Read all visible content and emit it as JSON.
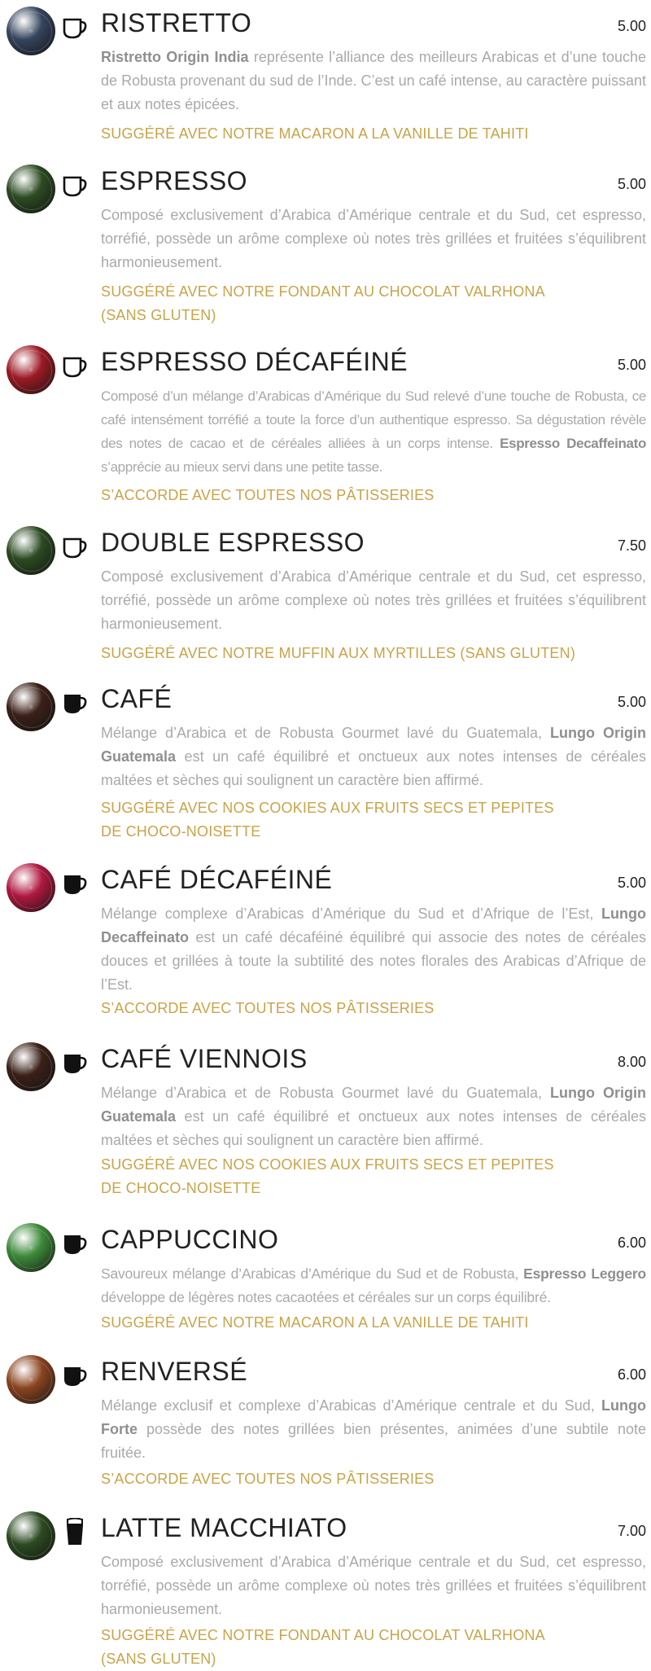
{
  "colors": {
    "title": "#222222",
    "description": "#a9a9a9",
    "pairing": "#c9a349"
  },
  "items": [
    {
      "title": "RISTRETTO",
      "price": "5.00",
      "cup_icon": "espresso-cup-icon",
      "capsule_color": "#35445d",
      "desc_pre": "",
      "desc_bold": "Ristretto Origin India",
      "desc_post": " représente l’alliance des meilleurs Arabicas et d’une touche de Robusta provenant du sud de l’Inde. C’est un café intense, au caractère puissant et aux notes épicées.",
      "pairing_1": "SUGGÉRÉ AVEC NOTRE MACARON A LA VANILLE DE TAHITI",
      "pairing_2": ""
    },
    {
      "title": "ESPRESSO",
      "price": "5.00",
      "cup_icon": "espresso-cup-icon",
      "capsule_color": "#2c4a22",
      "desc_pre": "Composé exclusivement d’Arabica d’Amérique centrale et du Sud, cet espresso, torréfié, possède un arôme complexe où notes très grillées et fruitées s’équilibrent harmonieusement.",
      "desc_bold": "",
      "desc_post": "",
      "pairing_1": "SUGGÉRÉ AVEC NOTRE FONDANT AU CHOCOLAT VALRHONA",
      "pairing_2": "(SANS GLUTEN)"
    },
    {
      "title": "ESPRESSO DÉCAFÉINÉ",
      "price": "5.00",
      "cup_icon": "espresso-cup-icon",
      "capsule_color": "#9c1a24",
      "desc_pre": "Composé d’un mélange d’Arabicas d’Amérique du Sud relevé d’une touche de Robusta, ce café intensément torréfié a toute la force d’un authentique espresso. Sa dégustation révèle des notes de cacao et de céréales alliées à un corps intense. ",
      "desc_bold": "Espresso Decaffeinato",
      "desc_post": " s’apprécie au mieux servi dans une petite tasse.",
      "pairing_1": "S’ACCORDE AVEC TOUTES NOS PÂTISSERIES",
      "pairing_2": ""
    },
    {
      "title": "DOUBLE ESPRESSO",
      "price": "7.50",
      "cup_icon": "espresso-cup-icon",
      "capsule_color": "#2c4a22",
      "desc_pre": "Composé exclusivement d’Arabica d’Amérique centrale et du Sud, cet espresso, torréfié, possède un arôme complexe où notes très grillées et fruitées s’équilibrent harmonieusement.",
      "desc_bold": "",
      "desc_post": "",
      "pairing_1": "SUGGÉRÉ AVEC NOTRE MUFFIN AUX MYRTILLES (SANS GLUTEN)",
      "pairing_2": ""
    },
    {
      "title": "CAFÉ",
      "price": "5.00",
      "cup_icon": "coffee-cup-icon",
      "capsule_color": "#3a2018",
      "desc_pre": "Mélange d’Arabica et de Robusta Gourmet lavé du Guatemala, ",
      "desc_bold": "Lungo Origin Guatemala",
      "desc_post": " est un café équilibré et onctueux aux notes intenses de céréales maltées et sèches qui soulignent un caractère bien affirmé.",
      "pairing_1": "SUGGÉRÉ AVEC NOS COOKIES AUX FRUITS SECS ET PEPITES",
      "pairing_2": "DE CHOCO-NOISETTE"
    },
    {
      "title": "CAFÉ DÉCAFÉINÉ",
      "price": "5.00",
      "cup_icon": "coffee-cup-icon",
      "capsule_color": "#b01840",
      "desc_pre": "Mélange complexe d’Arabicas d’Amérique du Sud et d’Afrique de l’Est, ",
      "desc_bold": "Lungo Decaffeinato",
      "desc_post": " est un café décaféiné équilibré qui associe des notes de céréales douces et grillées à toute la subtilité des notes florales des Arabicas d’Afrique de l’Est.",
      "pairing_1": "S’ACCORDE AVEC TOUTES NOS PÂTISSERIES",
      "pairing_2": ""
    },
    {
      "title": "CAFÉ VIENNOIS",
      "price": "8.00",
      "cup_icon": "coffee-cup-icon",
      "capsule_color": "#3a2018",
      "desc_pre": "Mélange d’Arabica et de Robusta Gourmet lavé du Guatemala, ",
      "desc_bold": "Lungo Origin Guatemala",
      "desc_post": " est un café équilibré et onctueux aux notes intenses de céréales maltées et sèches qui soulignent un caractère bien affirmé.",
      "pairing_1": "SUGGÉRÉ AVEC NOS COOKIES AUX FRUITS SECS ET PEPITES",
      "pairing_2": "DE CHOCO-NOISETTE"
    },
    {
      "title": "CAPPUCCINO",
      "price": "6.00",
      "cup_icon": "coffee-cup-icon",
      "capsule_color": "#3d8a3a",
      "desc_pre": "Savoureux mélange d’Arabicas d’Amérique du Sud et de Robusta, ",
      "desc_bold": "Espresso Leggero",
      "desc_post": " développe de légères notes cacaotées et céréales sur un corps équilibré.",
      "pairing_1": "SUGGÉRÉ AVEC NOTRE MACARON A LA VANILLE DE TAHITI",
      "pairing_2": ""
    },
    {
      "title": "RENVERSÉ",
      "price": "6.00",
      "cup_icon": "coffee-cup-icon",
      "capsule_color": "#8a4420",
      "desc_pre": "Mélange exclusif et complexe d’Arabicas d’Amérique centrale et du Sud, ",
      "desc_bold": "Lungo Forte",
      "desc_post": " possède des notes grillées bien présentes, animées d’une subtile note fruitée.",
      "pairing_1": "S’ACCORDE AVEC TOUTES NOS PÂTISSERIES",
      "pairing_2": ""
    },
    {
      "title": "LATTE MACCHIATO",
      "price": "7.00",
      "cup_icon": "latte-glass-icon",
      "capsule_color": "#2c4a22",
      "desc_pre": "Composé exclusivement d’Arabica d’Amérique centrale et du Sud, cet espresso, torréfié, possède un arôme complexe où notes très grillées et fruitées s’équilibrent harmonieusement.",
      "desc_bold": "",
      "desc_post": "",
      "pairing_1": "SUGGÉRÉ AVEC NOTRE FONDANT AU CHOCOLAT VALRHONA",
      "pairing_2": "(SANS GLUTEN)"
    }
  ]
}
